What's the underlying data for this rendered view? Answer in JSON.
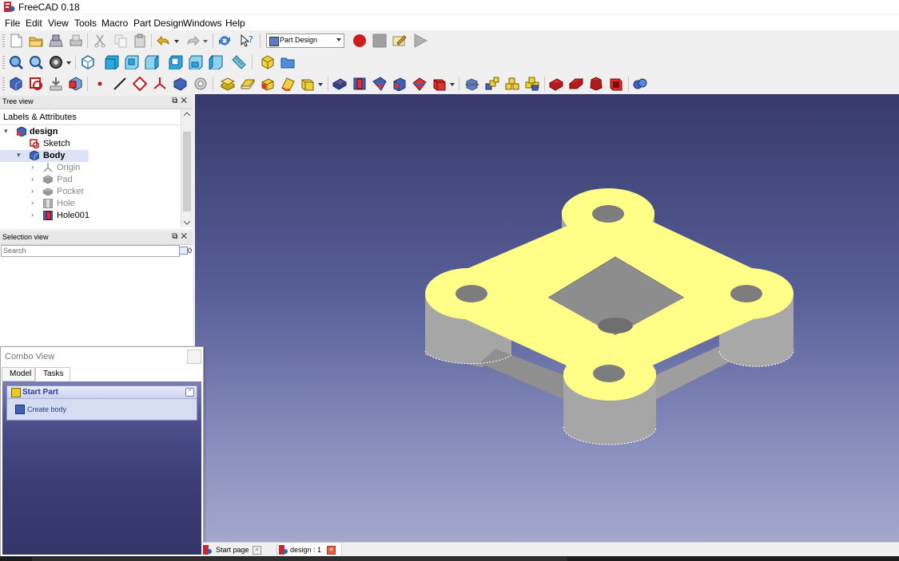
{
  "window": {
    "title": "FreeCAD 0.18"
  },
  "menu": [
    "File",
    "Edit",
    "View",
    "Tools",
    "Macro",
    "Part Design",
    "Windows",
    "Help"
  ],
  "toolbar": {
    "workbench": "Part Design"
  },
  "tree_view": {
    "title": "Tree view",
    "header": "Labels & Attributes",
    "items": [
      {
        "label": "design",
        "bold": true
      },
      {
        "label": "Sketch"
      },
      {
        "label": "Body",
        "bold": true
      },
      {
        "label": "Origin",
        "muted": true
      },
      {
        "label": "Pad",
        "muted": true
      },
      {
        "label": "Pocket",
        "muted": true
      },
      {
        "label": "Hole",
        "muted": true
      },
      {
        "label": "Hole001"
      }
    ]
  },
  "selection_view": {
    "title": "Selection view",
    "search_placeholder": "Search",
    "count": "0"
  },
  "combo_view": {
    "title": "Combo View",
    "tabs": [
      "Model",
      "Tasks"
    ],
    "active_tab": "Tasks",
    "task_panel": {
      "title": "Start Part",
      "action": "Create body"
    }
  },
  "document_tabs": [
    "Start page",
    "design : 1"
  ],
  "colors": {
    "face_top": "#ffff88",
    "face_side": "#a7a7a7",
    "view_top": "#363a6b",
    "view_bottom": "#a3a8cc"
  }
}
